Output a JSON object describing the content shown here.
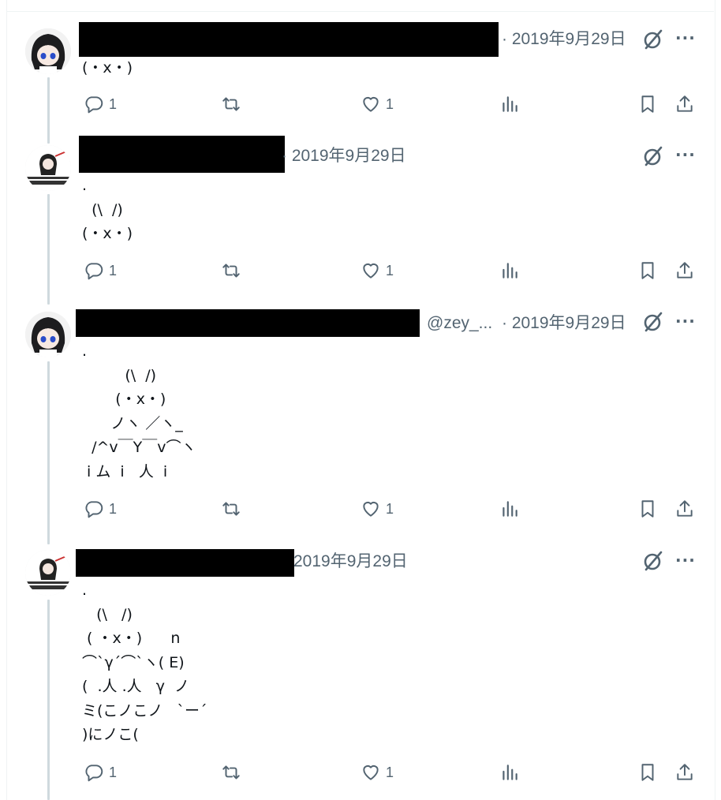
{
  "tweets": [
    {
      "handle": "",
      "date": "· 2019年9月29日",
      "text": "(・x・)",
      "reply_count": "1",
      "like_count": "1"
    },
    {
      "handle": "",
      "date": "· 2019年9月29日",
      "text": ".\n  (\\  /)\n(・x・)",
      "reply_count": "1",
      "like_count": "1"
    },
    {
      "handle": "@zey_...",
      "date": "· 2019年9月29日",
      "text": ".\n         (\\  /)\n       (・x・)\n      ノヽ ／ヽ_\n  /^v￣Y￣v⌒ヽ\n i ム  i   人  i",
      "reply_count": "1",
      "like_count": "1"
    },
    {
      "handle": "",
      "date": "2019年9月29日",
      "text": ".\n   (\\   /)\n ( ・x・)      n\n⌒`γ´⌒`ヽ( E)\n(  .人 .人   γ  ノ\nミ(こノこノ   `ー´\n)にノこ(",
      "reply_count": "1",
      "like_count": "1"
    }
  ],
  "icons": {
    "reply": "reply-icon",
    "retweet": "retweet-icon",
    "like": "like-icon",
    "views": "views-icon",
    "bookmark": "bookmark-icon",
    "share": "share-icon",
    "grok": "grok-icon",
    "more": "more-icon"
  },
  "colors": {
    "icon": "#536471",
    "text": "#0f1419",
    "thread": "#cfd9de"
  }
}
